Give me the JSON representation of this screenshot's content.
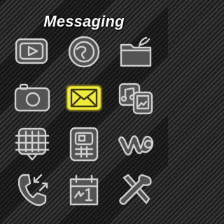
{
  "screen": {
    "title": "Messaging"
  },
  "menu": {
    "selected": "messaging",
    "items": [
      {
        "id": "media",
        "icon": "play-icon"
      },
      {
        "id": "internet",
        "icon": "globe-icon"
      },
      {
        "id": "file-manager",
        "icon": "folder-icon"
      },
      {
        "id": "camera",
        "icon": "camera-icon"
      },
      {
        "id": "messaging",
        "icon": "envelope-icon"
      },
      {
        "id": "media-player",
        "icon": "music-photo-icon"
      },
      {
        "id": "contacts",
        "icon": "phonebook-icon"
      },
      {
        "id": "organizer",
        "icon": "calculator-icon"
      },
      {
        "id": "walkman",
        "icon": "walkman-icon"
      },
      {
        "id": "call-log",
        "icon": "call-log-icon"
      },
      {
        "id": "calendar",
        "icon": "calendar-icon"
      },
      {
        "id": "settings",
        "icon": "tools-icon"
      }
    ]
  },
  "colors": {
    "accent": "#f0ea3a",
    "icon_stroke": "#cfcfcf",
    "tile_fill": "#545454"
  }
}
